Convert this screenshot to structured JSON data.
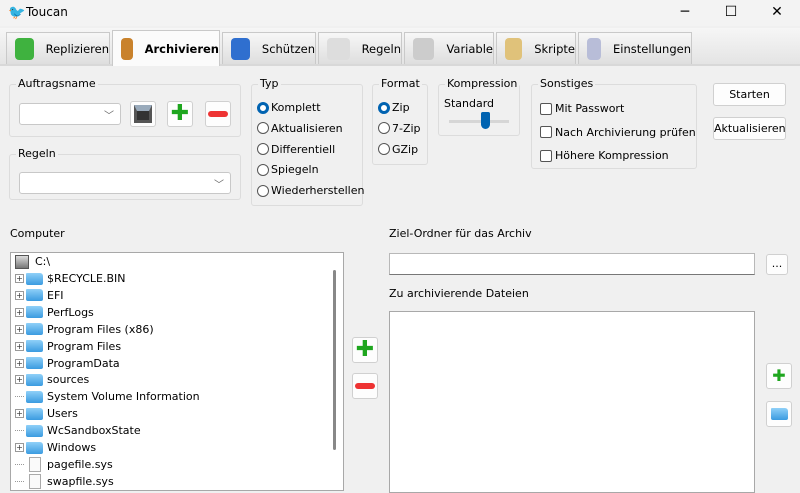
{
  "window": {
    "title": "Toucan",
    "minimize": "─",
    "maximize": "☐",
    "close": "✕"
  },
  "tabs": [
    {
      "label": "Replizieren",
      "icon": "sync-icon",
      "color": "#3fb23f"
    },
    {
      "label": "Archivieren",
      "icon": "box-icon",
      "color": "#c9822c"
    },
    {
      "label": "Schützen",
      "icon": "shield-icon",
      "color": "#2f6fcf"
    },
    {
      "label": "Regeln",
      "icon": "paragraph-icon",
      "color": "#dddddd"
    },
    {
      "label": "Variable",
      "icon": "var-icon",
      "color": "#cccccc"
    },
    {
      "label": "Skripte",
      "icon": "script-icon",
      "color": "#e0c27a"
    },
    {
      "label": "Einstellungen",
      "icon": "gears-icon",
      "color": "#b8bdd8"
    }
  ],
  "job": {
    "label": "Auftragsname",
    "value": ""
  },
  "rules": {
    "label": "Regeln",
    "value": ""
  },
  "type": {
    "label": "Typ",
    "options": [
      "Komplett",
      "Aktualisieren",
      "Differentiell",
      "Spiegeln",
      "Wiederherstellen"
    ],
    "selected": 0
  },
  "format": {
    "label": "Format",
    "options": [
      "Zip",
      "7-Zip",
      "GZip"
    ],
    "selected": 0
  },
  "compression": {
    "label": "Kompression",
    "value_label": "Standard",
    "level_fraction": 0.6
  },
  "other": {
    "label": "Sonstiges",
    "options": [
      {
        "label": "Mit Passwort",
        "checked": false
      },
      {
        "label": "Nach Archivierung prüfen",
        "checked": false
      },
      {
        "label": "Höhere Kompression",
        "checked": false
      }
    ]
  },
  "buttons": {
    "start": "Starten",
    "refresh": "Aktualisieren",
    "browse": "..."
  },
  "computer": {
    "label": "Computer",
    "root": "C:\\",
    "items": [
      {
        "name": "$RECYCLE.BIN",
        "type": "folder",
        "expandable": true
      },
      {
        "name": "EFI",
        "type": "folder",
        "expandable": true
      },
      {
        "name": "PerfLogs",
        "type": "folder",
        "expandable": true
      },
      {
        "name": "Program Files (x86)",
        "type": "folder",
        "expandable": true
      },
      {
        "name": "Program Files",
        "type": "folder",
        "expandable": true
      },
      {
        "name": "ProgramData",
        "type": "folder",
        "expandable": true
      },
      {
        "name": "sources",
        "type": "folder",
        "expandable": true
      },
      {
        "name": "System Volume Information",
        "type": "folder",
        "expandable": false
      },
      {
        "name": "Users",
        "type": "folder",
        "expandable": true
      },
      {
        "name": "WcSandboxState",
        "type": "folder",
        "expandable": false
      },
      {
        "name": "Windows",
        "type": "folder",
        "expandable": true
      },
      {
        "name": "pagefile.sys",
        "type": "file",
        "expandable": false
      },
      {
        "name": "swapfile.sys",
        "type": "file",
        "expandable": false
      }
    ]
  },
  "target": {
    "label": "Ziel-Ordner für das Archiv",
    "value": ""
  },
  "files": {
    "label": "Zu archivierende Dateien",
    "items": []
  }
}
